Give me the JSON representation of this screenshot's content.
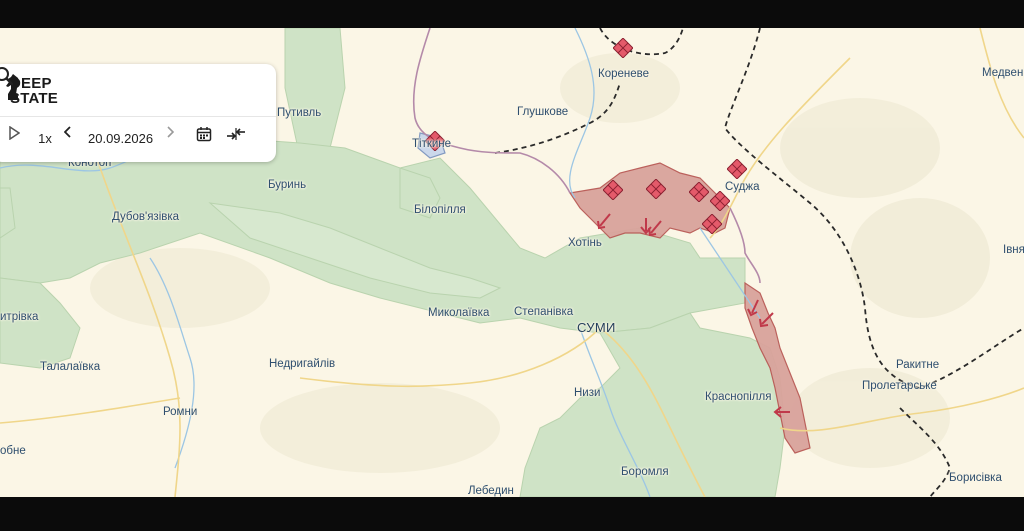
{
  "app": {
    "logo_line1": "DEEP",
    "logo_line2": "STATE"
  },
  "controls": {
    "speed": "1x",
    "date": "20.09.2026"
  },
  "places": {
    "koreneve": "Кореневе",
    "medven": "Медвен",
    "putyvl": "Путивль",
    "hlushkove": "Глушкове",
    "tetkine": "Тіткине",
    "konotop": "Конотоп",
    "burun": "Буринь",
    "sudzha": "Суджа",
    "dubovyazivka": "Дубов'язівка",
    "bilopillia": "Білопілля",
    "khotin": "Хотінь",
    "ivnia": "Івня",
    "dmytrivka": "итрівка",
    "mykolaivka": "Миколаївка",
    "stepanivka": "Степанівка",
    "sumy": "СУМИ",
    "talalaivka": "Талалаївка",
    "nedryhailiv": "Недригайлів",
    "rokytne": "Ракитне",
    "prolytarske": "Пролетарське",
    "nyzy": "Низи",
    "krasnopillia": "Краснопілля",
    "romny": "Ромни",
    "lokhvytsia": "обне",
    "boromlia": "Боромля",
    "borysivka": "Борисівка",
    "lebedyn": "Лебедин"
  },
  "colors": {
    "land": "#fbf6e6",
    "liberated": "#cfe3c6",
    "occupied": "#d9a39c",
    "border": "#2a2a2a",
    "attack": "#c0394a"
  }
}
